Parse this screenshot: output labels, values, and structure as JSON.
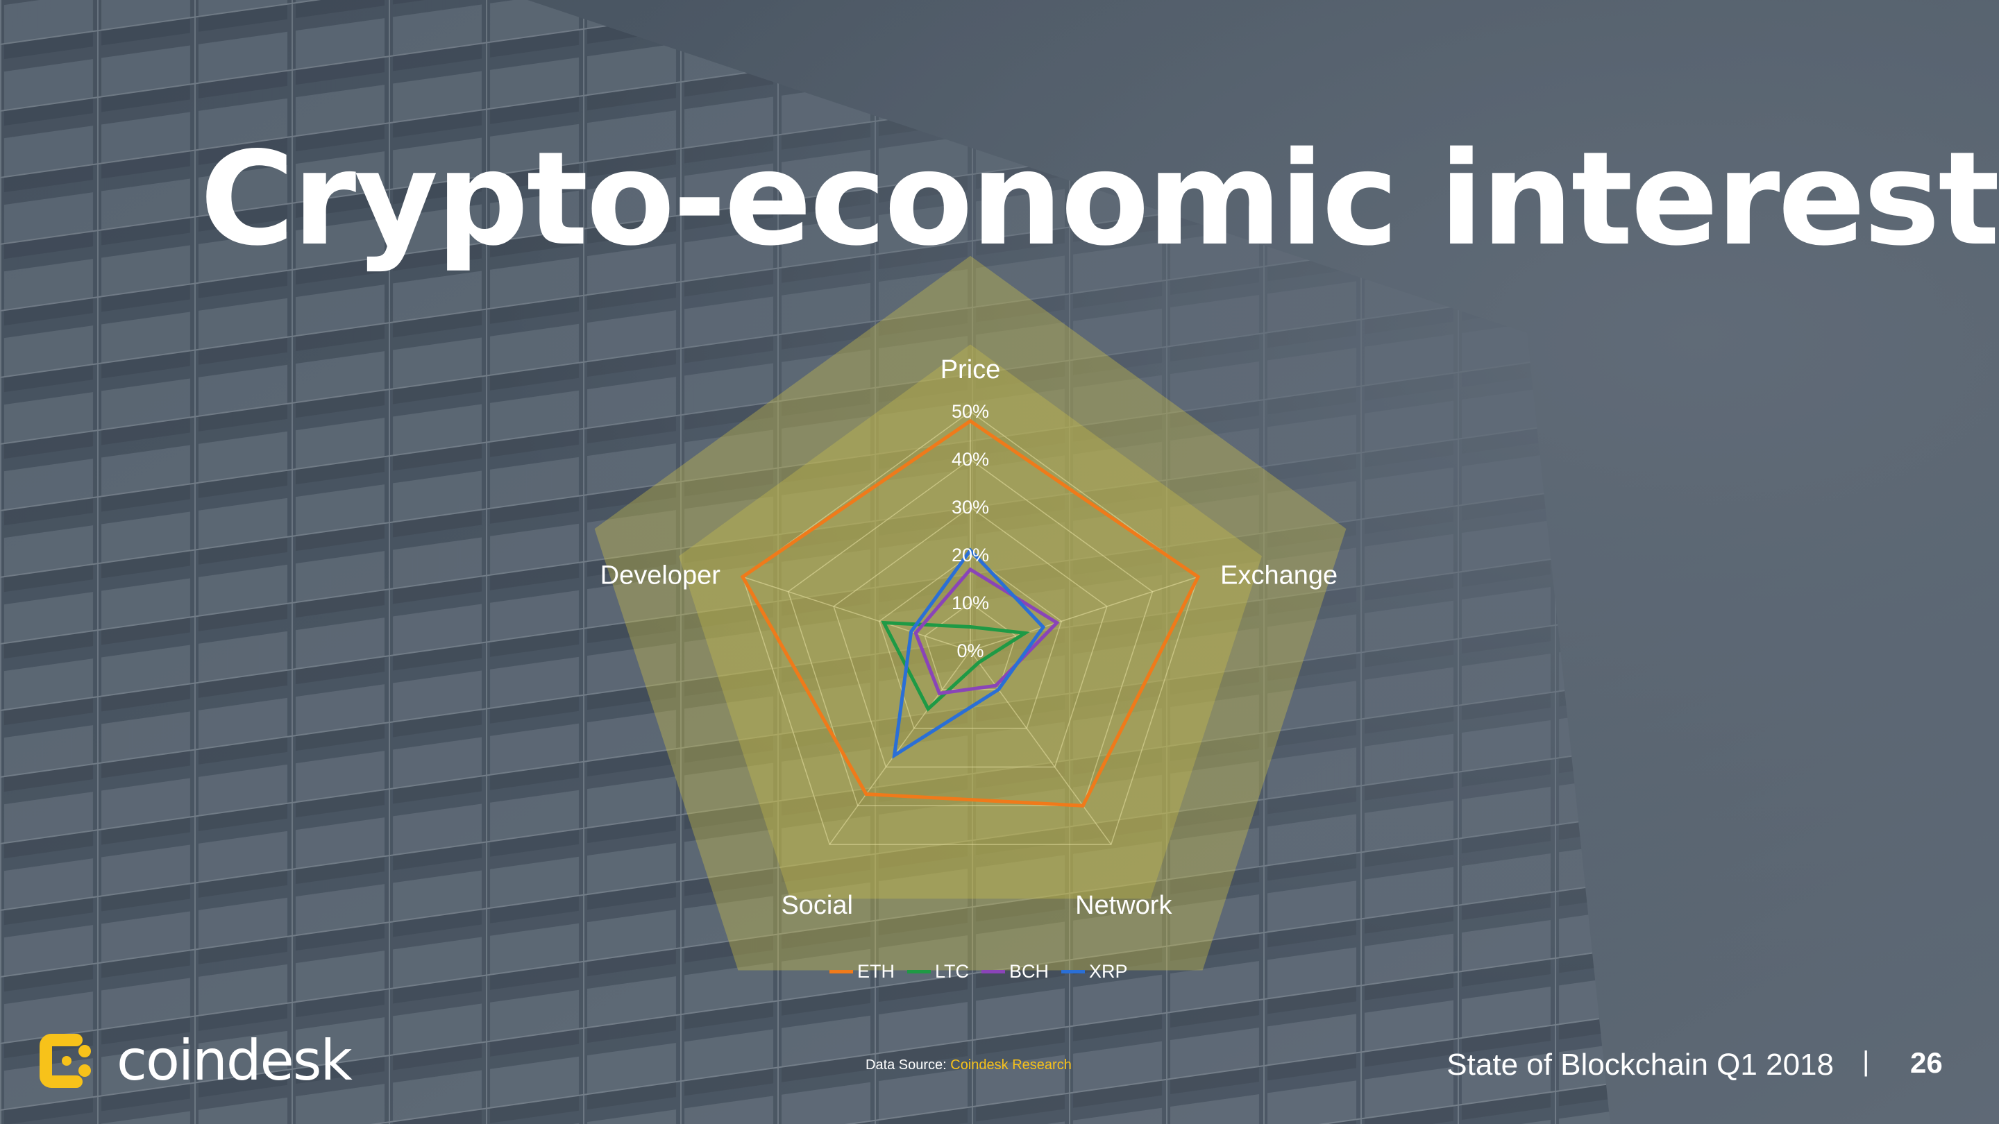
{
  "slide": {
    "title": "Crypto-economic interest",
    "title_dot": ".",
    "accent_color": "#f7c21a"
  },
  "footer": {
    "logo_text": "coindesk",
    "logo_icon": "coindesk-logo-icon",
    "source_label": "Data Source: ",
    "source_value": "Coindesk Research",
    "report_title": "State of Blockchain Q1 2018",
    "separator": "|",
    "page_number": "26"
  },
  "chart_data": {
    "type": "radar",
    "axes": [
      "Price",
      "Exchange",
      "Network",
      "Social",
      "Developer"
    ],
    "ticks": [
      "0%",
      "10%",
      "20%",
      "30%",
      "40%",
      "50%"
    ],
    "rlim": [
      0,
      50
    ],
    "series": [
      {
        "name": "ETH",
        "color": "#f07a1a",
        "values": [
          48,
          50,
          40,
          37,
          50
        ]
      },
      {
        "name": "LTC",
        "color": "#1e9a45",
        "values": [
          5,
          12,
          3,
          15,
          19
        ]
      },
      {
        "name": "BCH",
        "color": "#8a44b8",
        "values": [
          17,
          19,
          9,
          11,
          12
        ]
      },
      {
        "name": "XRP",
        "color": "#2a6fd6",
        "values": [
          21,
          16,
          10,
          27,
          13
        ]
      }
    ],
    "legend_position": "bottom",
    "grid": true,
    "fill_color": "#cfc24a"
  }
}
